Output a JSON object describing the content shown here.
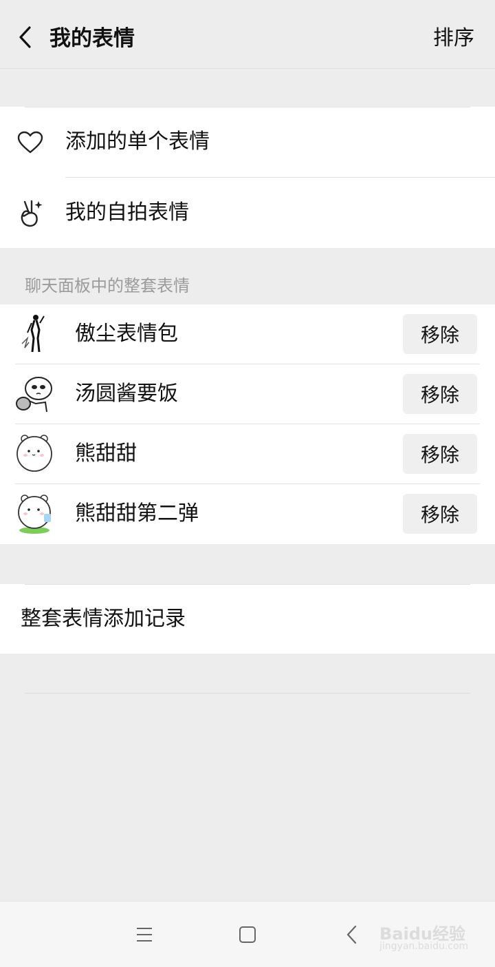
{
  "header": {
    "title": "我的表情",
    "sort_label": "排序",
    "back_icon": "chevron-left-icon"
  },
  "menu": {
    "items": [
      {
        "label": "添加的单个表情",
        "icon": "heart-icon"
      },
      {
        "label": "我的自拍表情",
        "icon": "victory-hand-icon"
      }
    ]
  },
  "packs": {
    "section_title": "聊天面板中的整套表情",
    "items": [
      {
        "name": "傲尘表情包",
        "button": "移除"
      },
      {
        "name": "汤圆酱要饭",
        "button": "移除"
      },
      {
        "name": "熊甜甜",
        "button": "移除"
      },
      {
        "name": "熊甜甜第二弹",
        "button": "移除"
      }
    ]
  },
  "history": {
    "label": "整套表情添加记录"
  },
  "navbar": {
    "icons": [
      "menu-icon",
      "home-square-icon",
      "back-icon"
    ]
  },
  "watermark": {
    "brand": "Baidu经验",
    "sub": "jingyan.baidu.com"
  }
}
